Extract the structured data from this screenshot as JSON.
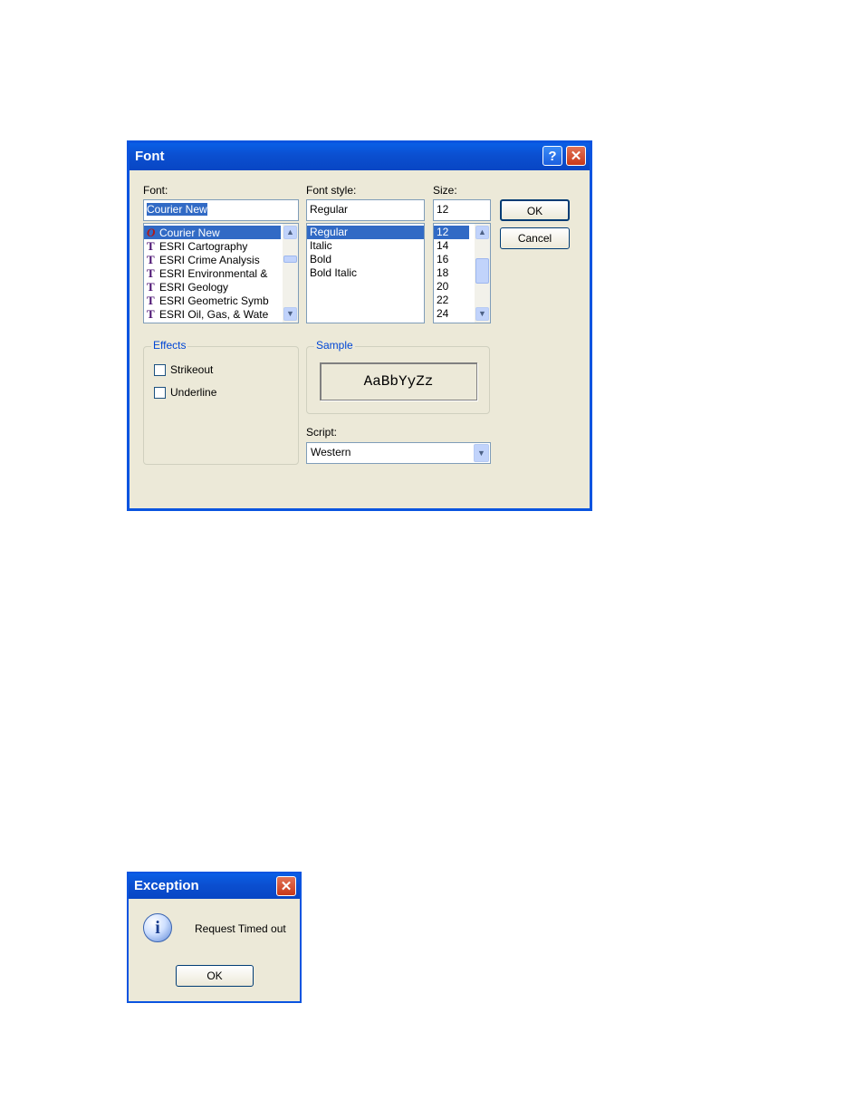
{
  "font_dialog": {
    "title": "Font",
    "help_glyph": "?",
    "close_glyph": "✕",
    "font_label": "Font:",
    "font_value": "Courier New",
    "fonts": [
      {
        "label": "Courier New",
        "icon": "opentype-icon",
        "glyph": "O"
      },
      {
        "label": "ESRI Cartography",
        "icon": "truetype-icon",
        "glyph": "T"
      },
      {
        "label": "ESRI Crime Analysis",
        "icon": "truetype-icon",
        "glyph": "T"
      },
      {
        "label": "ESRI Environmental &",
        "icon": "truetype-icon",
        "glyph": "T"
      },
      {
        "label": "ESRI Geology",
        "icon": "truetype-icon",
        "glyph": "T"
      },
      {
        "label": "ESRI Geometric Symb",
        "icon": "truetype-icon",
        "glyph": "T"
      },
      {
        "label": "ESRI Oil, Gas, & Wate",
        "icon": "truetype-icon",
        "glyph": "T"
      }
    ],
    "style_label": "Font style:",
    "style_value": "Regular",
    "styles": [
      "Regular",
      "Italic",
      "Bold",
      "Bold Italic"
    ],
    "size_label": "Size:",
    "size_value": "12",
    "sizes": [
      "12",
      "14",
      "16",
      "18",
      "20",
      "22",
      "24"
    ],
    "ok_label": "OK",
    "cancel_label": "Cancel",
    "effects_label": "Effects",
    "strikeout_label": "Strikeout",
    "strikeout_checked": false,
    "underline_label": "Underline",
    "underline_checked": false,
    "sample_label": "Sample",
    "sample_text": "AaBbYyZz",
    "script_label": "Script:",
    "script_value": "Western"
  },
  "exception_dialog": {
    "title": "Exception",
    "close_glyph": "✕",
    "message": "Request Timed out",
    "info_glyph": "i",
    "ok_label": "OK"
  },
  "colors": {
    "titlebar": "#0a54e0",
    "dialog_bg": "#ece9d8",
    "selection": "#316ac5",
    "group_title": "#0046d5"
  }
}
